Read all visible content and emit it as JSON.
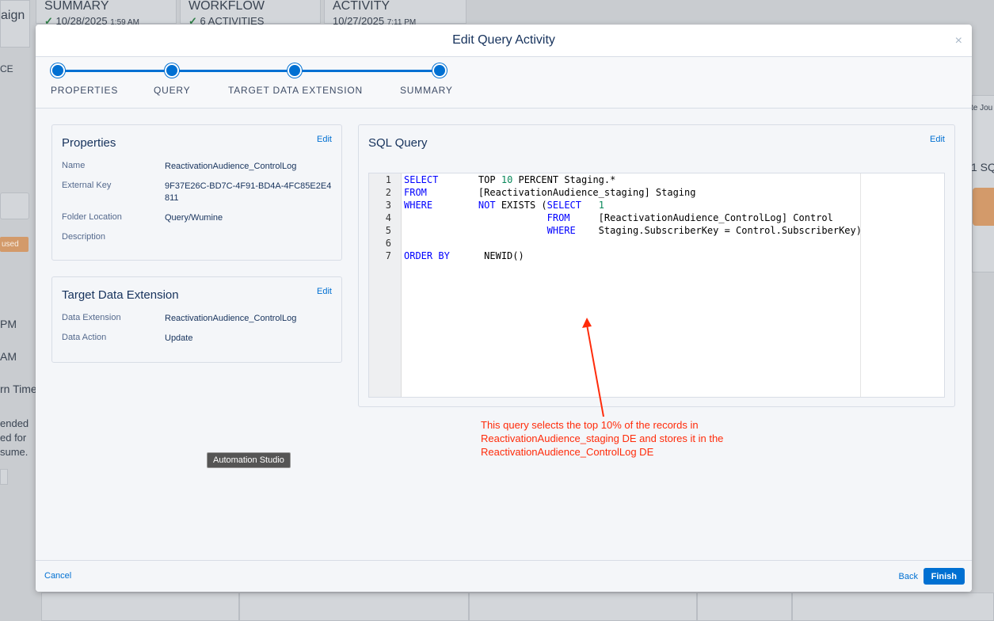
{
  "background": {
    "header_cards": [
      {
        "title": "SUMMARY",
        "subtitle_main": "10/28/2025",
        "subtitle_small": "1:59 AM"
      },
      {
        "title": "WORKFLOW",
        "subtitle_main": "6 ACTIVITIES",
        "subtitle_small": ""
      },
      {
        "title": "ACTIVITY",
        "subtitle_main": "10/27/2025",
        "subtitle_small": "7:11 PM"
      }
    ],
    "left_fragments": [
      "aign",
      "CE",
      "used",
      "PM",
      "AM",
      "rn Time",
      "ended",
      "ed for",
      "sume."
    ],
    "right_fragments": [
      "te Jou",
      "1 SQ"
    ]
  },
  "modal": {
    "title": "Edit Query Activity",
    "close_glyph": "×",
    "steps": [
      "PROPERTIES",
      "QUERY",
      "TARGET DATA EXTENSION",
      "SUMMARY"
    ],
    "properties": {
      "title": "Properties",
      "edit_label": "Edit",
      "rows": [
        {
          "key": "Name",
          "value": "ReactivationAudience_ControlLog"
        },
        {
          "key": "External Key",
          "value": "9F37E26C-BD7C-4F91-BD4A-4FC85E2E4811"
        },
        {
          "key": "Folder Location",
          "value": "Query/Wumine"
        },
        {
          "key": "Description",
          "value": ""
        }
      ]
    },
    "target": {
      "title": "Target Data Extension",
      "edit_label": "Edit",
      "rows": [
        {
          "key": "Data Extension",
          "value": "ReactivationAudience_ControlLog"
        },
        {
          "key": "Data Action",
          "value": "Update"
        }
      ]
    },
    "sql": {
      "title": "SQL Query",
      "edit_label": "Edit",
      "line_numbers": [
        "1",
        "2",
        "3",
        "4",
        "5",
        "6",
        "7"
      ]
    },
    "annotation": "This query selects the top 10% of the records in ReactivationAudience_staging DE and stores it in the ReactivationAudience_ControlLog DE",
    "tooltip": "Automation Studio",
    "footer": {
      "cancel_label": "Cancel",
      "back_label": "Back",
      "finish_label": "Finish"
    },
    "accent_color": "#0070d2",
    "annotation_color": "#ff2b0a"
  }
}
